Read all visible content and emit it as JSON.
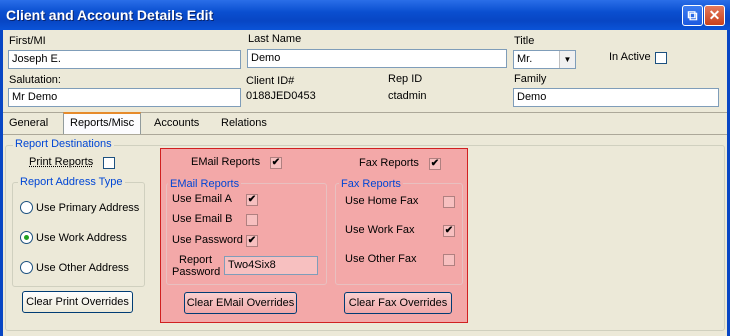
{
  "window": {
    "title": "Client and Account Details Edit"
  },
  "fields": {
    "first_mi": {
      "label": "First/MI",
      "value": "Joseph E."
    },
    "last_name": {
      "label": "Last Name",
      "value": "Demo"
    },
    "title": {
      "label": "Title",
      "value": "Mr."
    },
    "in_active": {
      "label": "In Active"
    },
    "salutation": {
      "label": "Salutation:",
      "value": "Mr Demo"
    },
    "client_id": {
      "label": "Client ID#",
      "value": "0188JED0453"
    },
    "rep_id": {
      "label": "Rep ID",
      "value": "ctadmin"
    },
    "family": {
      "label": "Family",
      "value": "Demo"
    }
  },
  "tabs": [
    "General",
    "Reports/Misc",
    "Accounts",
    "Relations"
  ],
  "report_destinations": {
    "label": "Report Destinations",
    "print_reports": "Print Reports",
    "address_type": {
      "label": "Report Address Type",
      "options": [
        "Use Primary Address",
        "Use Work Address",
        "Use Other Address"
      ],
      "selected": "Use Work Address"
    },
    "clear_print": "Clear Print Overrides"
  },
  "email": {
    "email_reports": "EMail Reports",
    "group_label": "EMail Reports",
    "use_email_a": "Use Email A",
    "use_email_b": "Use Email B",
    "use_password": "Use Password",
    "report_password_label_1": "Report",
    "report_password_label_2": "Password",
    "report_password_value": "Two4Six8",
    "clear": "Clear EMail Overrides"
  },
  "fax": {
    "fax_reports": "Fax Reports",
    "group_label": "Fax Reports",
    "use_home_fax": "Use Home Fax",
    "use_work_fax": "Use Work Fax",
    "use_other_fax": "Use Other Fax",
    "clear": "Clear Fax Overrides"
  },
  "glyphs": {
    "check": "✔",
    "dropdown": "▼",
    "restore": "⧉",
    "close": "✕"
  }
}
